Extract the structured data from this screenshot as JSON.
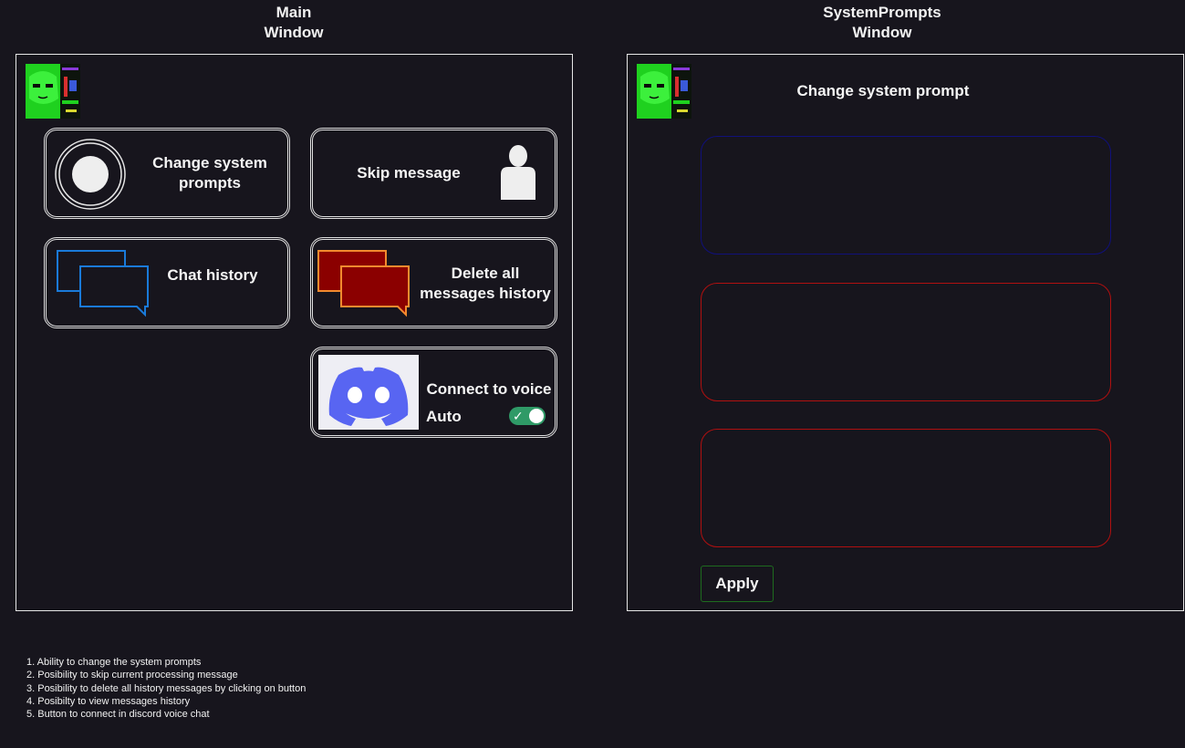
{
  "main_window": {
    "title_line1": "Main",
    "title_line2": "Window",
    "buttons": {
      "change_system_prompts": {
        "line1": "Change system",
        "line2": "prompts"
      },
      "skip_message": {
        "label": "Skip message"
      },
      "chat_history": {
        "label": "Chat history"
      },
      "delete_history": {
        "line1": "Delete all",
        "line2": "messages history"
      },
      "connect_voice": {
        "label": "Connect to voice",
        "auto_label": "Auto",
        "auto_enabled": true
      }
    }
  },
  "system_prompts_window": {
    "title_line1": "SystemPrompts",
    "title_line2": "Window",
    "heading": "Change system prompt",
    "prompt_fields": [
      {
        "value": "",
        "border_color": "#10107a"
      },
      {
        "value": "",
        "border_color": "#b01010"
      },
      {
        "value": "",
        "border_color": "#b01010"
      }
    ],
    "apply_label": "Apply"
  },
  "notes": [
    "1. Ability to change the system prompts",
    "2. Posibility to skip current processing message",
    "3. Posibility to delete all history messages by clicking on button",
    "4. Posibilty to view messages history",
    "5. Button to connect in discord voice chat"
  ],
  "colors": {
    "background": "#17151d",
    "chat_icon_blue": "#1a7ad9",
    "delete_icon_fill": "#8b0000",
    "delete_icon_stroke": "#f28a2e",
    "discord_blurple": "#5865f2",
    "toggle_green": "#2f9a67",
    "apply_border": "#1e6b1e"
  }
}
